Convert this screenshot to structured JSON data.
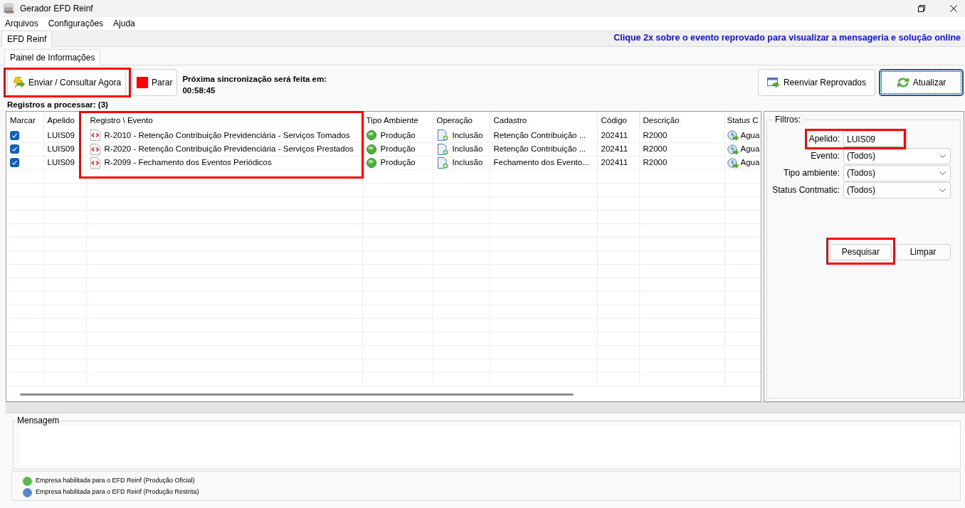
{
  "window": {
    "title": "Gerador EFD Reinf"
  },
  "menu": [
    {
      "label": "Arquivos"
    },
    {
      "label": "Configurações"
    },
    {
      "label": "Ajuda"
    }
  ],
  "main_tabs": [
    {
      "label": "EFD Reinf",
      "selected": true
    }
  ],
  "hint": "Clique 2x sobre o evento reprovado para visualizar a mensageria e solução online",
  "panel_tabs": [
    {
      "label": "Painel de Informações",
      "selected": true
    }
  ],
  "toolbar": {
    "left_buttons": [
      {
        "kind": "send",
        "label": "Enviar / Consultar Agora",
        "highlighted": true
      },
      {
        "kind": "stop",
        "label": "Parar",
        "highlighted": false
      }
    ],
    "sync_label": "Próxima sincronização será feita em:",
    "sync_time": "00:58:45",
    "right_buttons": [
      {
        "kind": "resend",
        "label": "Reenviar Reprovados",
        "focused": false
      },
      {
        "kind": "refresh",
        "label": "Atualizar",
        "focused": true
      }
    ]
  },
  "table": {
    "title": "Registros a processar: (3)",
    "columns": [
      {
        "label": "Marcar",
        "highlighted": false
      },
      {
        "label": "Apelido",
        "highlighted": false
      },
      {
        "label": "Registro \\ Evento",
        "highlighted": true
      },
      {
        "label": "Tipo Ambiente",
        "highlighted": false
      },
      {
        "label": "Operação",
        "highlighted": false
      },
      {
        "label": "Cadastro",
        "highlighted": false
      },
      {
        "label": "Código",
        "highlighted": false
      },
      {
        "label": "Descrição",
        "highlighted": false
      },
      {
        "label": "Status C",
        "highlighted": false
      }
    ],
    "rows": [
      {
        "checked": true,
        "apelido": "LUIS09",
        "evento": "R-2010 - Retenção Contribuição Previdenciária - Serviços Tomados",
        "ambiente": "Produção",
        "operacao": "Inclusão",
        "cadastro": "Retenção Contribuição ...",
        "codigo": "202411",
        "descricao": "R2000",
        "status": "Agua"
      },
      {
        "checked": true,
        "apelido": "LUIS09",
        "evento": "R-2020 - Retenção Contribuição Previdenciária - Serviços Prestados",
        "ambiente": "Produção",
        "operacao": "Inclusão",
        "cadastro": "Retenção Contribuição ...",
        "codigo": "202411",
        "descricao": "R2000",
        "status": "Agua"
      },
      {
        "checked": true,
        "apelido": "LUIS09",
        "evento": "R-2099 - Fechamento dos Eventos Periódicos",
        "ambiente": "Produção",
        "operacao": "Inclusão",
        "cadastro": "Fechamento dos Evento...",
        "codigo": "202411",
        "descricao": "R2000",
        "status": "Agua"
      }
    ]
  },
  "filters": {
    "title": "Filtros:",
    "fields": [
      {
        "kind": "text",
        "label": "Apelido:",
        "value": "LUIS09",
        "highlighted": true
      },
      {
        "kind": "dropdown",
        "label": "Evento:",
        "value": "(Todos)",
        "highlighted": false
      },
      {
        "kind": "dropdown",
        "label": "Tipo ambiente:",
        "value": "(Todos)",
        "highlighted": false
      },
      {
        "kind": "dropdown",
        "label": "Status Contmatic:",
        "value": "(Todos)",
        "highlighted": false
      }
    ],
    "buttons": [
      {
        "label": "Pesquisar",
        "highlighted": true
      },
      {
        "label": "Limpar",
        "highlighted": false
      }
    ]
  },
  "message": {
    "title": "Mensagem"
  },
  "legend": [
    {
      "text": "Empresa habilitada para o EFD Reinf (Produção Oficial)",
      "color": "#5cb84c"
    },
    {
      "text": "Empresa habilitada para o EFD Reinf (Produção Restrita)",
      "color": "#5b87c9"
    }
  ]
}
